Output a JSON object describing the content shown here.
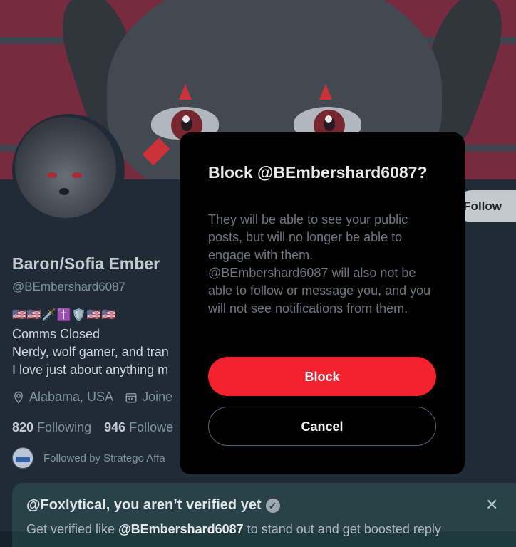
{
  "profile": {
    "follow_label": "Follow",
    "name": "Baron/Sofia Ember",
    "handle": "@BEmbershard6087",
    "emojis": "🇺🇸🇺🇸🗡️✝️🛡️🇺🇸🇺🇸",
    "bio_line1": "Comms Closed",
    "bio_line2": "Nerdy, wolf gamer, and tran",
    "bio_line3": "I love just about anything m",
    "location": "Alabama, USA",
    "joined": "Joine",
    "following_count": "820",
    "following_label": "Following",
    "followers_count": "946",
    "followers_label": "Followe",
    "followed_by": "Followed by Stratego Affa"
  },
  "verify_card": {
    "title": "@Foxlytical, you aren’t verified yet",
    "desc_prefix": "Get verified like ",
    "desc_handle": "@BEmbershard6087",
    "desc_suffix": " to stand out and get boosted reply"
  },
  "dialog": {
    "title": "Block @BEmbershard6087?",
    "body": "They will be able to see your public posts, but will no longer be able to engage with them. @BEmbershard6087 will also not be able to follow or message you, and you will not see notifications from them.",
    "block_label": "Block",
    "cancel_label": "Cancel"
  },
  "colors": {
    "background": "#15202b",
    "dialog_bg": "#000000",
    "block_red": "#f4212e",
    "banner": "#7b1f33"
  },
  "icons": {
    "location": "location-pin-icon",
    "calendar": "calendar-icon",
    "verified": "verified-badge-icon",
    "close": "close-icon"
  }
}
